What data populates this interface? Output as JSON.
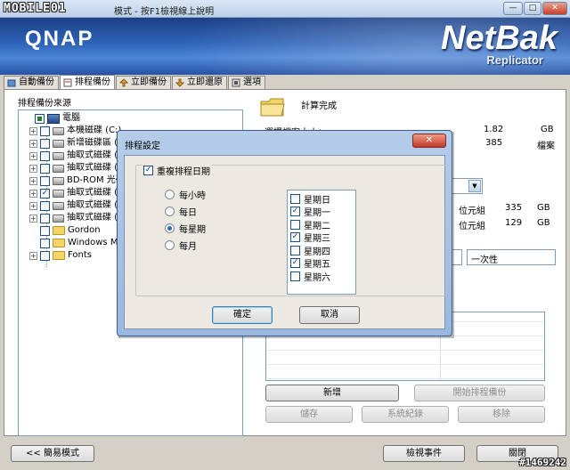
{
  "watermark_left": "MOBILE01",
  "watermark_right": "#1469242",
  "window": {
    "title": "模式 - 按F1檢視線上說明",
    "min": "—",
    "max": "□",
    "close": "✕"
  },
  "banner": {
    "brand": "QNAP",
    "product": "NetBak",
    "product_sub": "Replicator"
  },
  "tabs": [
    {
      "label": "自動備份",
      "icon": "auto-backup-icon"
    },
    {
      "label": "排程備份",
      "icon": "schedule-backup-icon",
      "active": true
    },
    {
      "label": "立即備份",
      "icon": "instant-backup-icon"
    },
    {
      "label": "立即還原",
      "icon": "restore-icon"
    },
    {
      "label": "選項",
      "icon": "options-icon"
    }
  ],
  "source": {
    "label": "排程備份來源",
    "items": [
      {
        "label": "電腦",
        "icon": "computer-icon",
        "level": 0,
        "checked": "partial"
      },
      {
        "label": "本機磁碟 (C:)",
        "icon": "drive-icon",
        "level": 1,
        "checked": "none"
      },
      {
        "label": "新增磁碟區 (D:)",
        "icon": "drive-icon",
        "level": 1,
        "checked": "none"
      },
      {
        "label": "抽取式磁碟 (E:)",
        "icon": "drive-icon",
        "level": 1,
        "checked": "none"
      },
      {
        "label": "抽取式磁碟 (F:)",
        "icon": "drive-icon",
        "level": 1,
        "checked": "none"
      },
      {
        "label": "BD-ROM 光碟機",
        "icon": "optical-drive-icon",
        "level": 1,
        "checked": "none"
      },
      {
        "label": "抽取式磁碟 (H:)",
        "icon": "drive-icon",
        "level": 1,
        "checked": "checked"
      },
      {
        "label": "抽取式磁碟 (I:)",
        "icon": "drive-icon",
        "level": 1,
        "checked": "none"
      },
      {
        "label": "抽取式磁碟 (J:)",
        "icon": "drive-icon",
        "level": 1,
        "checked": "none"
      },
      {
        "label": "Gordon",
        "icon": "user-folder-icon",
        "level": 1,
        "checked": "none"
      },
      {
        "label": "Windows Mail",
        "icon": "folder-icon",
        "level": 1,
        "checked": "none"
      },
      {
        "label": "Fonts",
        "icon": "folder-icon",
        "level": 1,
        "checked": "none"
      }
    ]
  },
  "info": {
    "status": "計算完成",
    "size_label": "選擇檔案大小：",
    "size_value": "1.82",
    "size_unit": "GB",
    "files_value": "385",
    "files_unit": "檔案",
    "free1_label": "位元組",
    "free1_value": "335",
    "free1_unit": "GB",
    "free2_label": "位元組",
    "free2_value": "129",
    "free2_unit": "GB",
    "frequency_value": "一次性"
  },
  "buttons": {
    "add": "新增",
    "start_schedule": "開始排程備份",
    "save": "儲存",
    "system_log": "系統紀錄",
    "remove": "移除",
    "simple_mode": "<< 簡易模式",
    "view_events": "檢視事件",
    "close": "關閉"
  },
  "dialog": {
    "title": "排程設定",
    "close": "✕",
    "repeat_label": "重複排程日期",
    "repeat_checked": true,
    "options": [
      {
        "label": "每小時",
        "selected": false
      },
      {
        "label": "每日",
        "selected": false
      },
      {
        "label": "每星期",
        "selected": true
      },
      {
        "label": "每月",
        "selected": false
      }
    ],
    "days": [
      {
        "label": "星期日",
        "checked": false
      },
      {
        "label": "星期一",
        "checked": true
      },
      {
        "label": "星期二",
        "checked": false
      },
      {
        "label": "星期三",
        "checked": true
      },
      {
        "label": "星期四",
        "checked": false
      },
      {
        "label": "星期五",
        "checked": true
      },
      {
        "label": "星期六",
        "checked": false
      }
    ],
    "ok": "確定",
    "cancel": "取消"
  }
}
